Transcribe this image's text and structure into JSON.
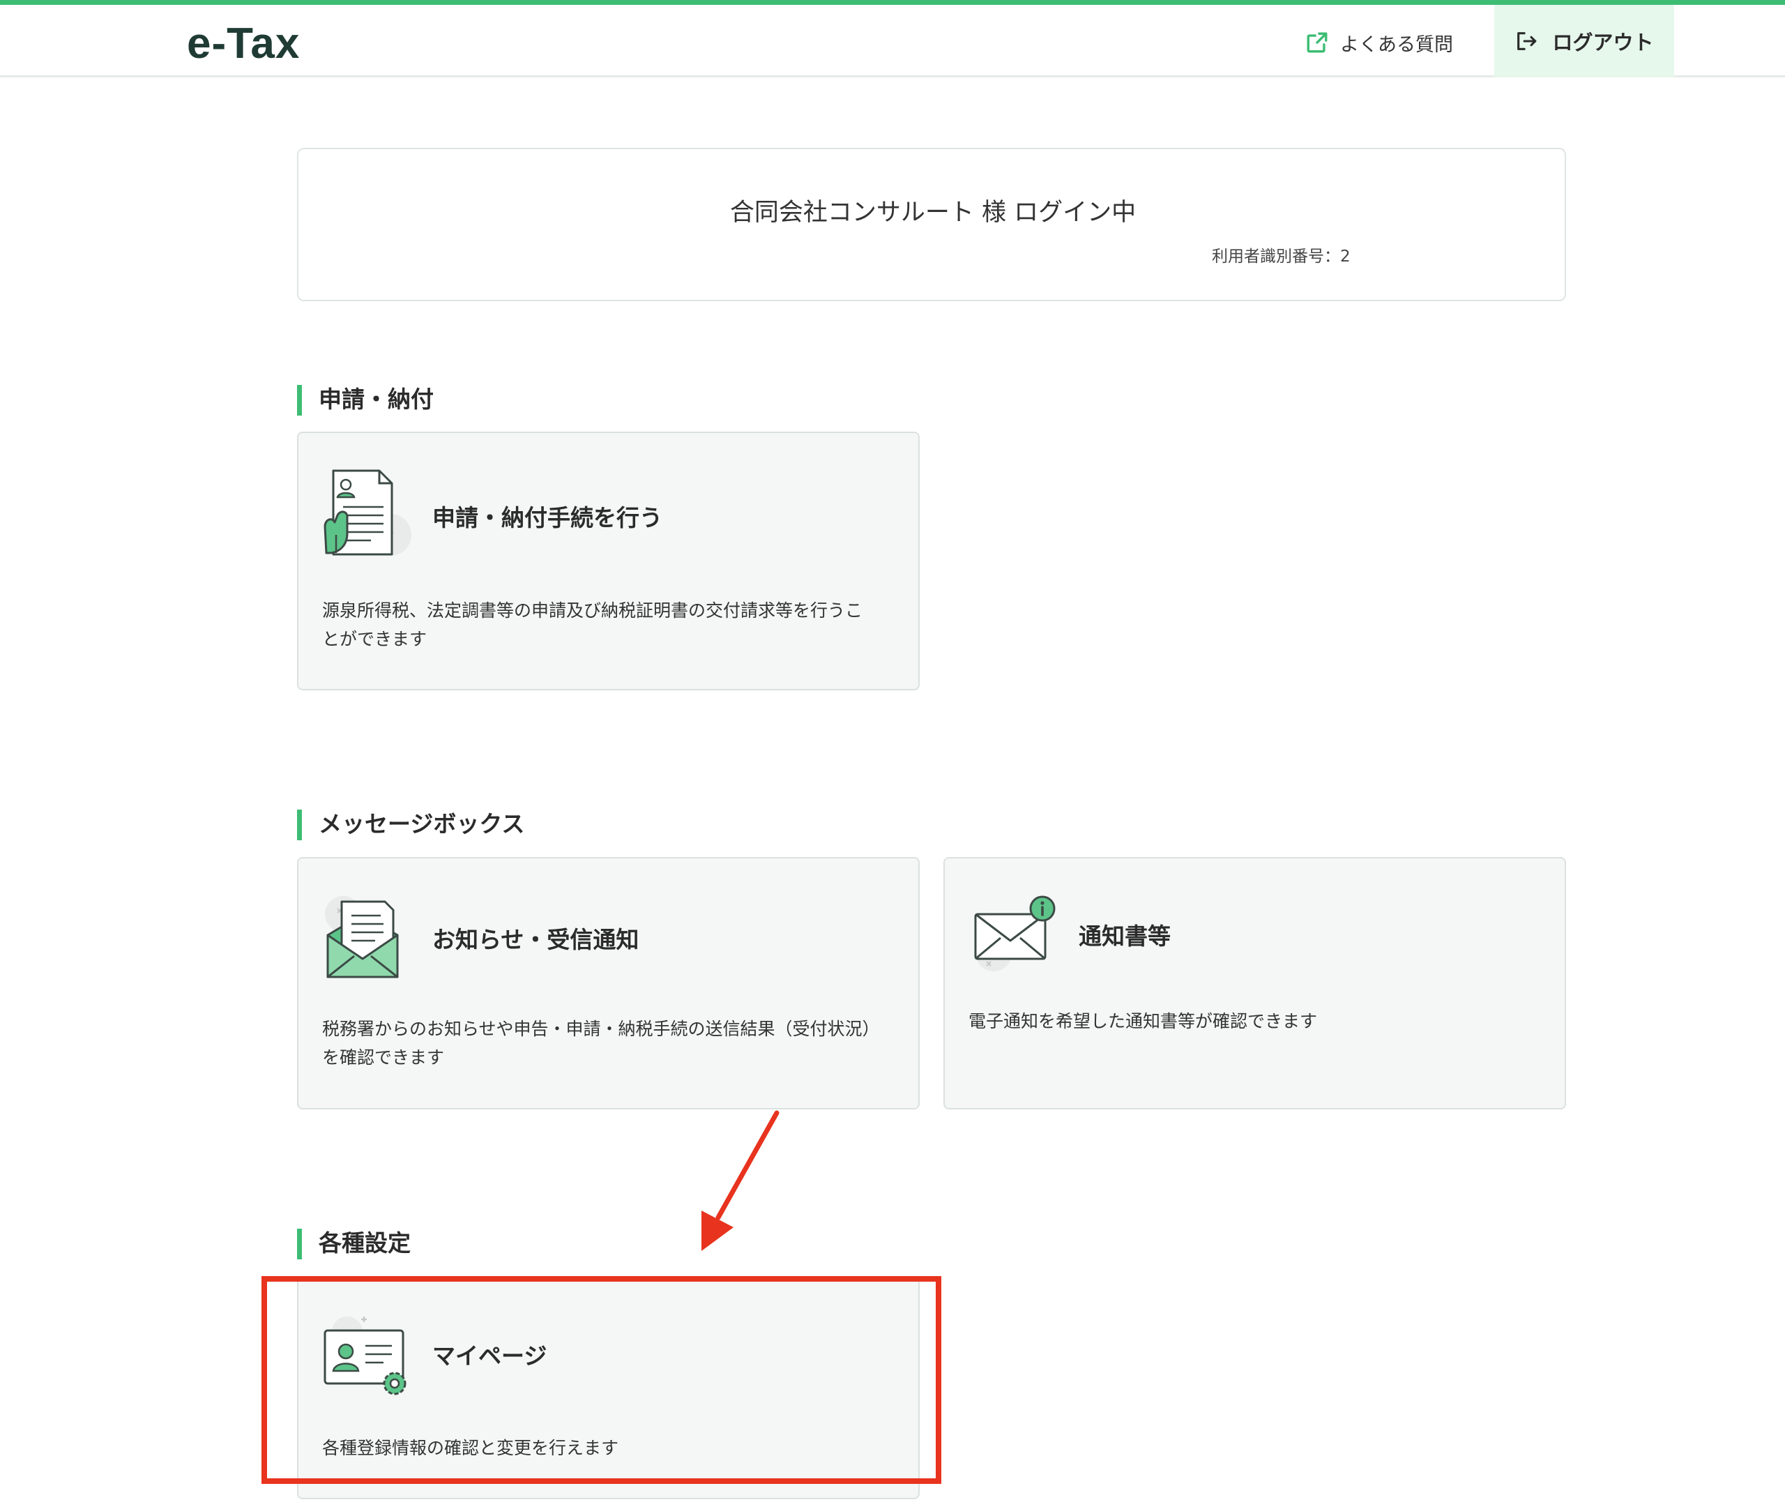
{
  "header": {
    "logo": "e-Tax",
    "faq_label": "よくある質問",
    "logout_label": "ログアウト"
  },
  "login": {
    "name": "合同会社コンサルート 様 ログイン中",
    "user_id_label": "利用者識別番号：2"
  },
  "sections": {
    "shinsei": {
      "title": "申請・納付",
      "card": {
        "title": "申請・納付手続を行う",
        "desc_line1": "源泉所得税、法定調書等の申請及び納税証明書の交付請求等を行うこ",
        "desc_line2": "とができます"
      }
    },
    "message": {
      "title": "メッセージボックス",
      "cards": [
        {
          "title": "お知らせ・受信通知",
          "desc_line1": "税務署からのお知らせや申告・申請・納税手続の送信結果（受付状況）",
          "desc_line2": "を確認できます"
        },
        {
          "title": "通知書等",
          "desc_line1": "電子通知を希望した通知書等が確認できます"
        }
      ]
    },
    "settings": {
      "title": "各種設定",
      "card": {
        "title": "マイページ",
        "desc_line1": "各種登録情報の確認と変更を行えます"
      }
    }
  },
  "colors": {
    "accent": "#3dbd74",
    "annotation": "#e8331e",
    "card_bg": "#f4f7f6"
  }
}
